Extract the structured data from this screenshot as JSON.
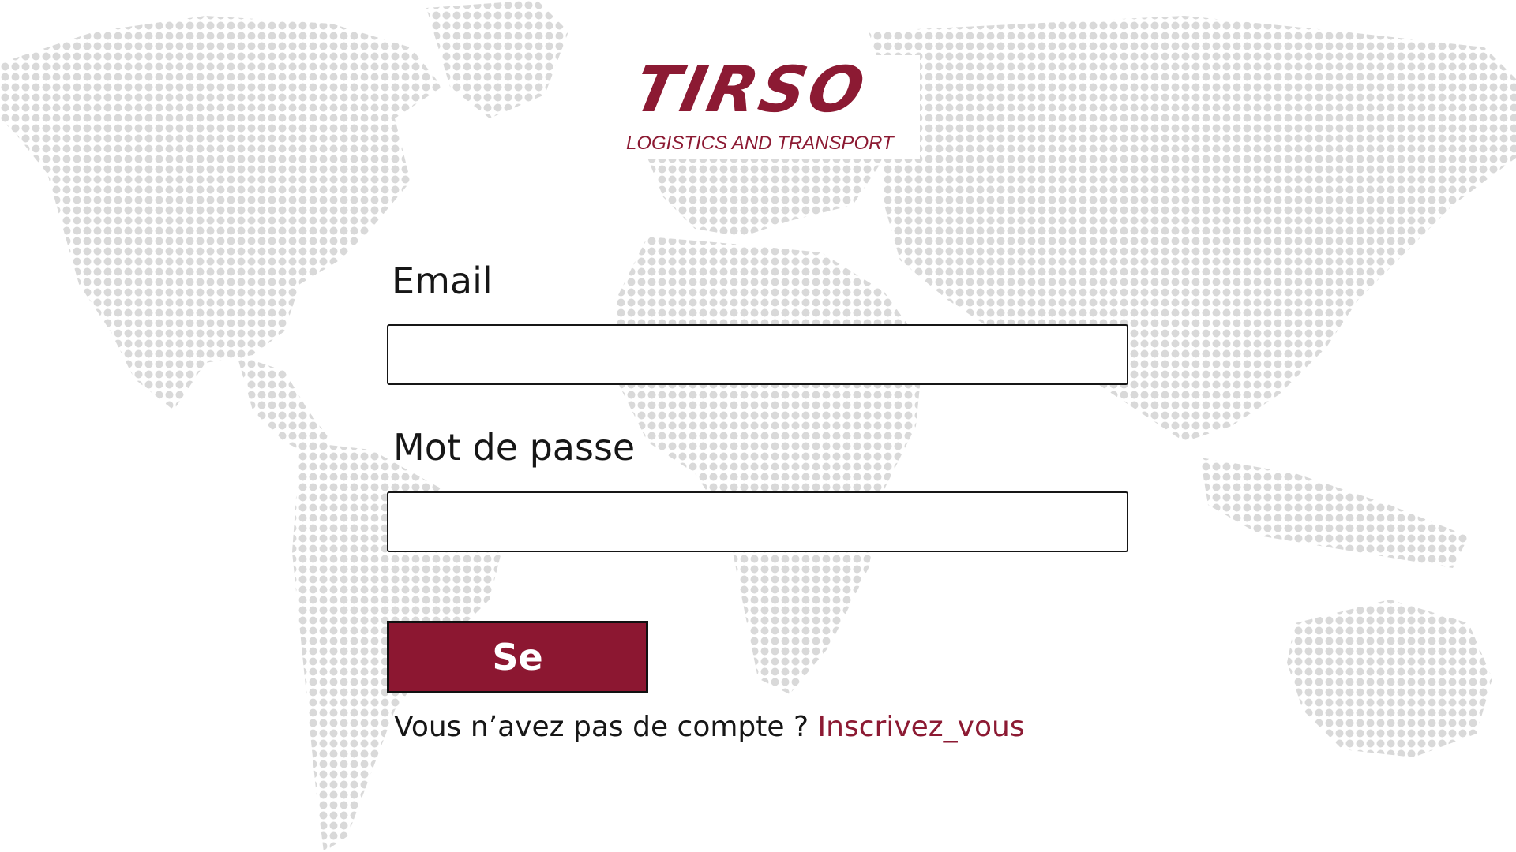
{
  "logo": {
    "wordmark": "TIRSO",
    "tagline": "LOGISTICS AND TRANSPORT",
    "brand_color": "#8c1a33"
  },
  "background": {
    "image": "dotted-world-map",
    "dot_color": "#d9d9d9"
  },
  "form": {
    "email_label": "Email",
    "email_value": "",
    "password_label": "Mot de passe",
    "password_value": "",
    "submit_label": "Se connecter",
    "submit_color": "#8c1731",
    "signup_prompt": "Vous n’avez pas de compte ? ",
    "signup_link": "Inscrivez_vous"
  }
}
